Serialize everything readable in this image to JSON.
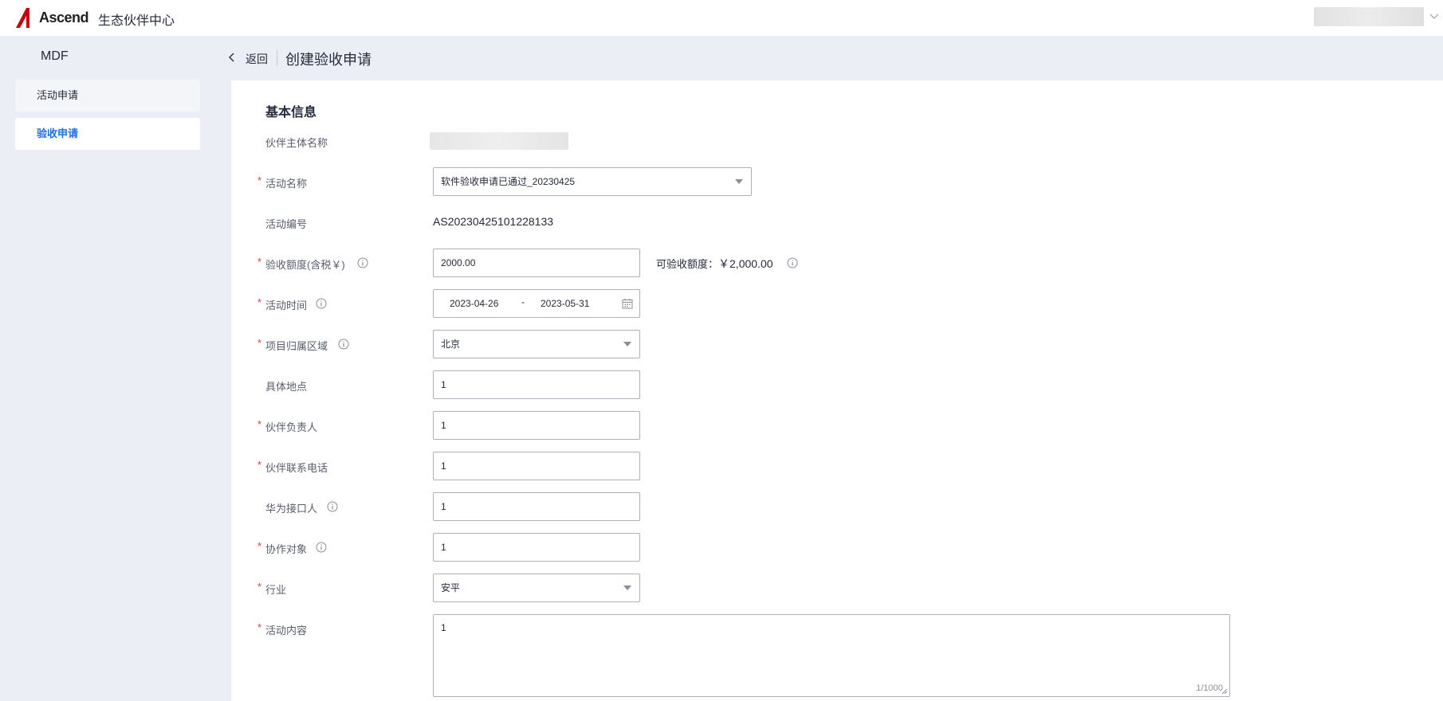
{
  "header": {
    "brand": "Ascend",
    "portal_title": "生态伙伴中心"
  },
  "sidebar": {
    "title": "MDF",
    "items": [
      {
        "label": "活动申请"
      },
      {
        "label": "验收申请"
      }
    ]
  },
  "page": {
    "back_label": "返回",
    "title": "创建验收申请"
  },
  "form": {
    "section_title": "基本信息",
    "partner_name": {
      "label": "伙伴主体名称"
    },
    "activity_name": {
      "label": "活动名称",
      "value": "软件验收申请已通过_20230425"
    },
    "activity_no": {
      "label": "活动编号",
      "value": "AS20230425101228133"
    },
    "amount": {
      "label": "验收额度(含税￥)",
      "value": "2000.00",
      "available_label": "可验收额度：",
      "available_value": "￥2,000.00"
    },
    "activity_time": {
      "label": "活动时间",
      "start": "2023-04-26",
      "sep": "-",
      "end": "2023-05-31"
    },
    "region": {
      "label": "项目归属区域",
      "value": "北京"
    },
    "location": {
      "label": "具体地点",
      "value": "1"
    },
    "partner_owner": {
      "label": "伙伴负责人",
      "value": "1"
    },
    "partner_phone": {
      "label": "伙伴联系电话",
      "value": "1"
    },
    "huawei_contact": {
      "label": "华为接口人",
      "value": "1"
    },
    "collab_target": {
      "label": "协作对象",
      "value": "1"
    },
    "industry": {
      "label": "行业",
      "value": "安平"
    },
    "activity_content": {
      "label": "活动内容",
      "value": "1",
      "counter": "1/1000"
    }
  },
  "colors": {
    "accent": "#1f6fe5",
    "required": "#e33d3d",
    "background": "#ebeef4",
    "logo_red": "#c7000b"
  }
}
